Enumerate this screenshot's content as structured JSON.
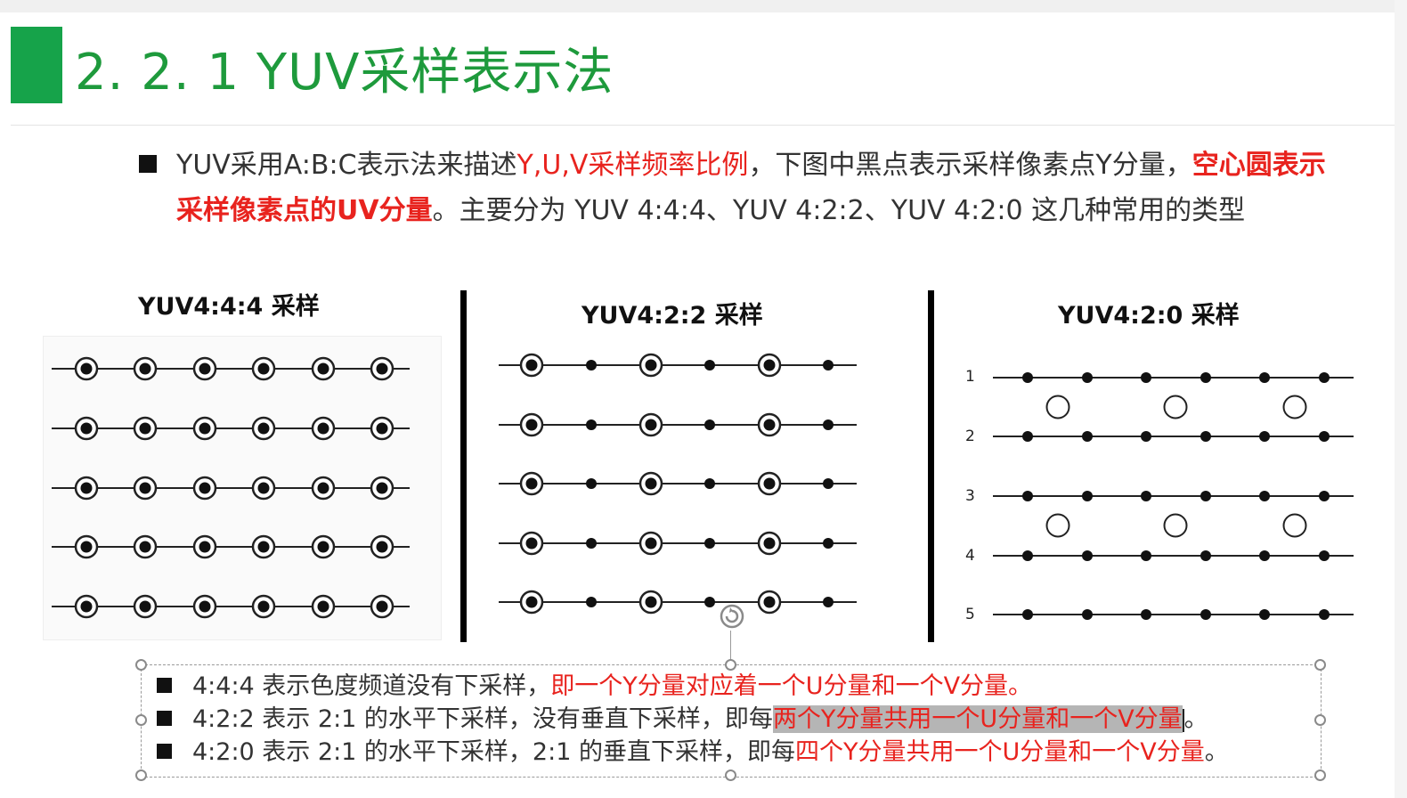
{
  "slide": {
    "title": "2. 2. 1  YUV采样表示法",
    "accent_color": "#16a34a",
    "intro": {
      "bullet_icon": "square-bullet",
      "text1": "YUV采用A:B:C表示法来描述",
      "text2": "Y,U,V采样频率比例",
      "text3": "，下图中黑点表示采样像素点Y分量，",
      "text4": "空心圆表示采样像素点的UV分量",
      "text5": "。主要分为 YUV 4:4:4、YUV 4:2:2、YUV 4:2:0 这几种常用的类型"
    },
    "figures": [
      {
        "title": "YUV4:4:4 采样"
      },
      {
        "title": "YUV4:2:2 采样"
      },
      {
        "title": "YUV4:2:0 采样",
        "row_numbers": [
          "1",
          "2",
          "3",
          "4",
          "5"
        ]
      }
    ],
    "bullets": [
      {
        "pre": "4:4:4 表示色度频道没有下采样，",
        "red": "即一个Y分量对应着一个U分量和一个V分量",
        "post": "。"
      },
      {
        "pre": "4:2:2 表示 2:1 的水平下采样，没有垂直下采样，即每",
        "highlight": "两个Y分量共用一个U分量和一个V分量",
        "post": "。"
      },
      {
        "pre": "4:2:0 表示 2:1 的水平下采样，2:1 的垂直下采样，即每",
        "red": "四个Y分量共用一个U分量和一个V分量",
        "post": "。"
      }
    ],
    "colors": {
      "red_text": "#e8231e",
      "title_green": "#1e9a3c",
      "highlight": "#b5b5b5"
    }
  }
}
